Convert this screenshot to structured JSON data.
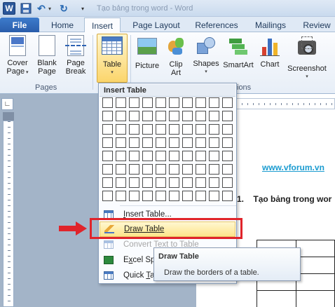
{
  "window": {
    "title": "Tạo bảng trong word - Word",
    "app_icon": "W"
  },
  "tabs": [
    {
      "label": "File"
    },
    {
      "label": "Home"
    },
    {
      "label": "Insert",
      "active": true
    },
    {
      "label": "Page Layout"
    },
    {
      "label": "References"
    },
    {
      "label": "Mailings"
    },
    {
      "label": "Review"
    }
  ],
  "ribbon": {
    "cover_page": {
      "line1": "Cover",
      "line2": "Page"
    },
    "blank_page": {
      "line1": "Blank",
      "line2": "Page"
    },
    "page_break": {
      "line1": "Page",
      "line2": "Break"
    },
    "pages_group": "Pages",
    "table": {
      "label": "Table"
    },
    "picture": {
      "label": "Picture"
    },
    "clip_art": {
      "line1": "Clip",
      "line2": "Art"
    },
    "shapes": {
      "label": "Shapes"
    },
    "smartart": {
      "label": "SmartArt"
    },
    "chart": {
      "label": "Chart"
    },
    "screenshot": {
      "label": "Screenshot"
    },
    "illustrations_group_partial": "ions"
  },
  "insert_table_menu": {
    "header": "Insert Table",
    "grid_cols": 10,
    "grid_rows": 8,
    "items": [
      {
        "label": "Insert Table...",
        "u": "I",
        "rest": "nsert Table..."
      },
      {
        "label": "Draw Table",
        "u": "D",
        "rest": "raw Table",
        "highlighted": true
      },
      {
        "label": "Convert Text to Table",
        "disabled": true
      },
      {
        "label": "Excel Sp",
        "u": "x",
        "pre": "E",
        "rest": "cel Spr"
      },
      {
        "label": "Quick Ta",
        "pre": "Quick ",
        "u": "T",
        "rest": "a"
      }
    ]
  },
  "tooltip": {
    "title": "Draw Table",
    "description": "Draw the borders of a table."
  },
  "document": {
    "link_text": "www.vforum.vn",
    "heading_number": "1.",
    "heading_text": "Tạo bảng trong wor"
  },
  "colors": {
    "accent": "#2a5699",
    "highlight": "#fde58a",
    "callout": "#e0242b",
    "link": "#1a9bd0"
  },
  "icons": [
    "word-icon",
    "save-icon",
    "undo-icon",
    "redo-icon",
    "customize-qat-icon",
    "cover-page-icon",
    "blank-page-icon",
    "page-break-icon",
    "table-icon",
    "picture-icon",
    "clip-art-icon",
    "shapes-icon",
    "smartart-icon",
    "chart-icon",
    "screenshot-icon",
    "screen-clipping-icon",
    "ruler-tab-icon",
    "insert-table-icon",
    "draw-table-icon",
    "convert-text-icon",
    "excel-icon",
    "quick-tables-icon"
  ]
}
